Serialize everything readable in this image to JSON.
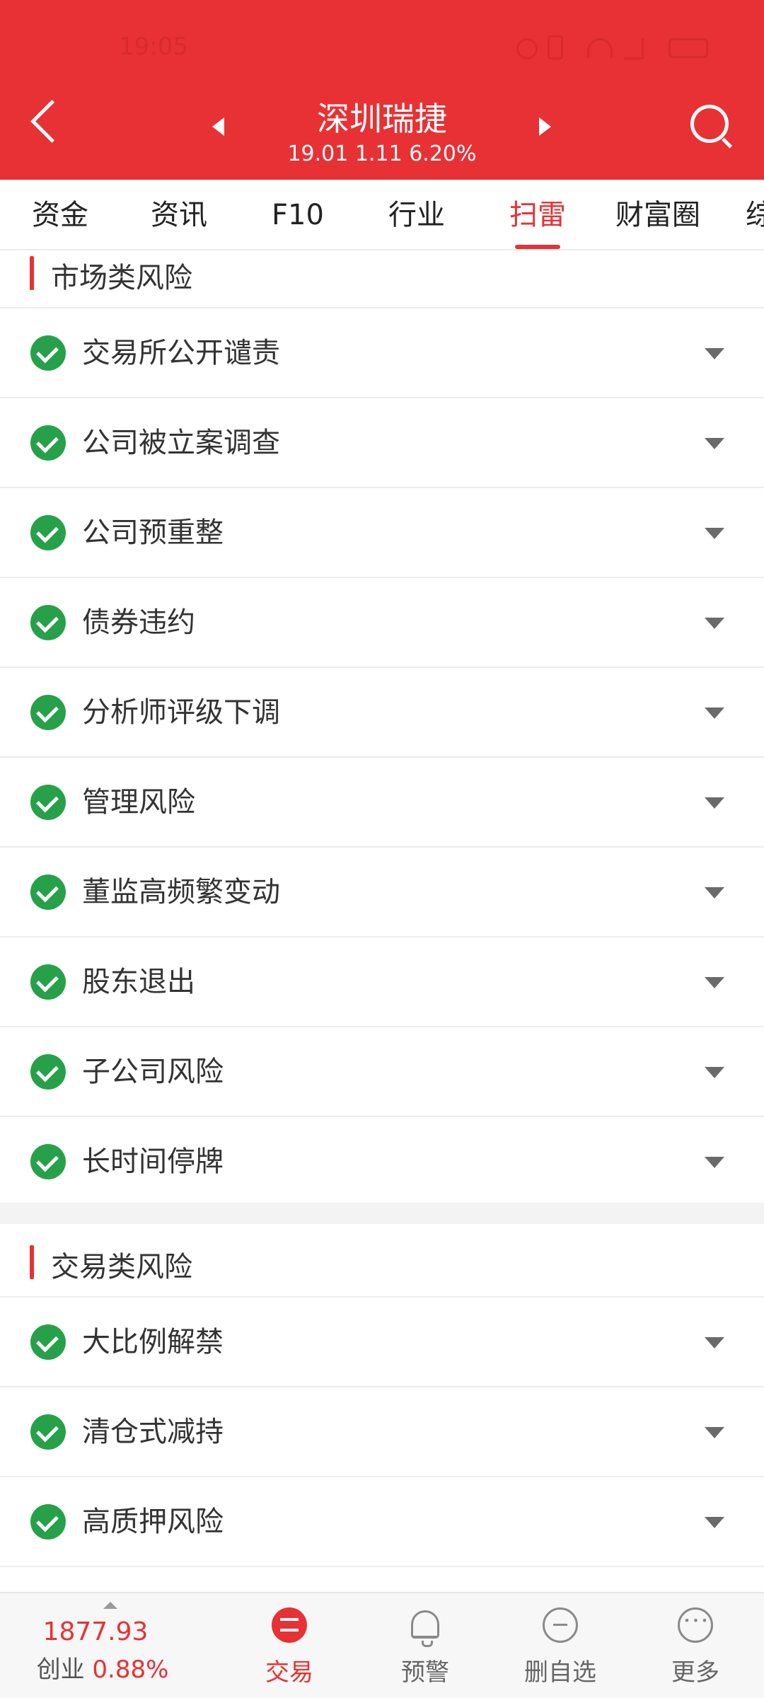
{
  "status_bar": {
    "time": "19:05"
  },
  "header": {
    "stock_name": "深圳瑞捷",
    "quote": "19.01 1.11 6.20%"
  },
  "tabs": [
    {
      "label": "资金"
    },
    {
      "label": "资讯"
    },
    {
      "label": "F10"
    },
    {
      "label": "行业"
    },
    {
      "label": "扫雷",
      "active": true
    },
    {
      "label": "财富圈"
    },
    {
      "label": "综"
    }
  ],
  "market_risk": {
    "title": "市场类风险",
    "items": [
      {
        "label": "交易所公开谴责"
      },
      {
        "label": "公司被立案调查"
      },
      {
        "label": "公司预重整"
      },
      {
        "label": "债券违约"
      },
      {
        "label": "分析师评级下调"
      },
      {
        "label": "管理风险"
      },
      {
        "label": "董监高频繁变动"
      },
      {
        "label": "股东退出"
      },
      {
        "label": "子公司风险"
      },
      {
        "label": "长时间停牌"
      }
    ]
  },
  "trade_risk": {
    "title": "交易类风险",
    "items": [
      {
        "label": "大比例解禁"
      },
      {
        "label": "清仓式减持"
      },
      {
        "label": "高质押风险"
      }
    ]
  },
  "bottom_bar": {
    "index_value": "1877.93",
    "index_name": "创业",
    "index_change": "0.88%",
    "nav": [
      {
        "label": "交易",
        "icon": "trade-icon",
        "active": true
      },
      {
        "label": "预警",
        "icon": "bell-icon"
      },
      {
        "label": "删自选",
        "icon": "minus-circle-icon"
      },
      {
        "label": "更多",
        "icon": "more-icon"
      }
    ]
  },
  "colors": {
    "brand_red": "#e83134",
    "check_green": "#27a149"
  }
}
